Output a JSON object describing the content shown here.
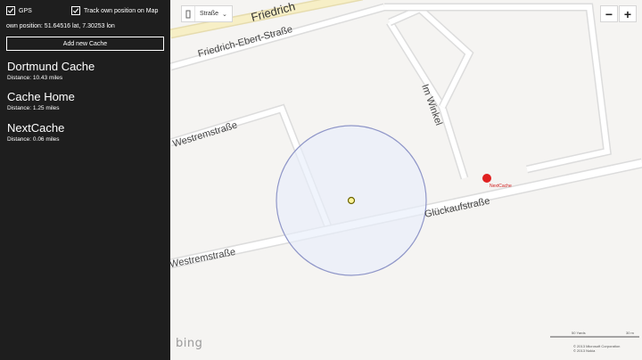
{
  "sidebar": {
    "gps_label": "GPS",
    "track_label": "Track own position on Map",
    "own_position": "own position: 51.64516 lat, 7.30253 lon",
    "add_button": "Add new Cache",
    "caches": [
      {
        "name": "Dortmund Cache",
        "distance": "Distance: 10.43 miles"
      },
      {
        "name": "Cache Home",
        "distance": "Distance: 1.25 miles"
      },
      {
        "name": "NextCache",
        "distance": "Distance: 0.06 miles"
      }
    ]
  },
  "map": {
    "style_value": "Straße",
    "zoom_out": "−",
    "zoom_in": "+",
    "streets": {
      "friedrich": "Friedrich",
      "friedrich_ebert": "Friedrich-Ebert-Straße",
      "im_winkel": "Im Winkel",
      "westrem_upper": "Westremstraße",
      "westrem_lower": "Westremstraße",
      "glueckauf": "Glückaufstraße"
    },
    "marker_label": "NextCache",
    "logo": "bing",
    "scale_yards": "50 Yards",
    "scale_m": "30 m",
    "copyright_1": "© 2013 Microsoft Corporation",
    "copyright_2": "© 2013 Nokia",
    "icons": {
      "gps": "checkbox-checked-icon",
      "track": "checkbox-checked-icon",
      "grip": "grip-icon",
      "chevron": "chevron-down-icon"
    }
  }
}
